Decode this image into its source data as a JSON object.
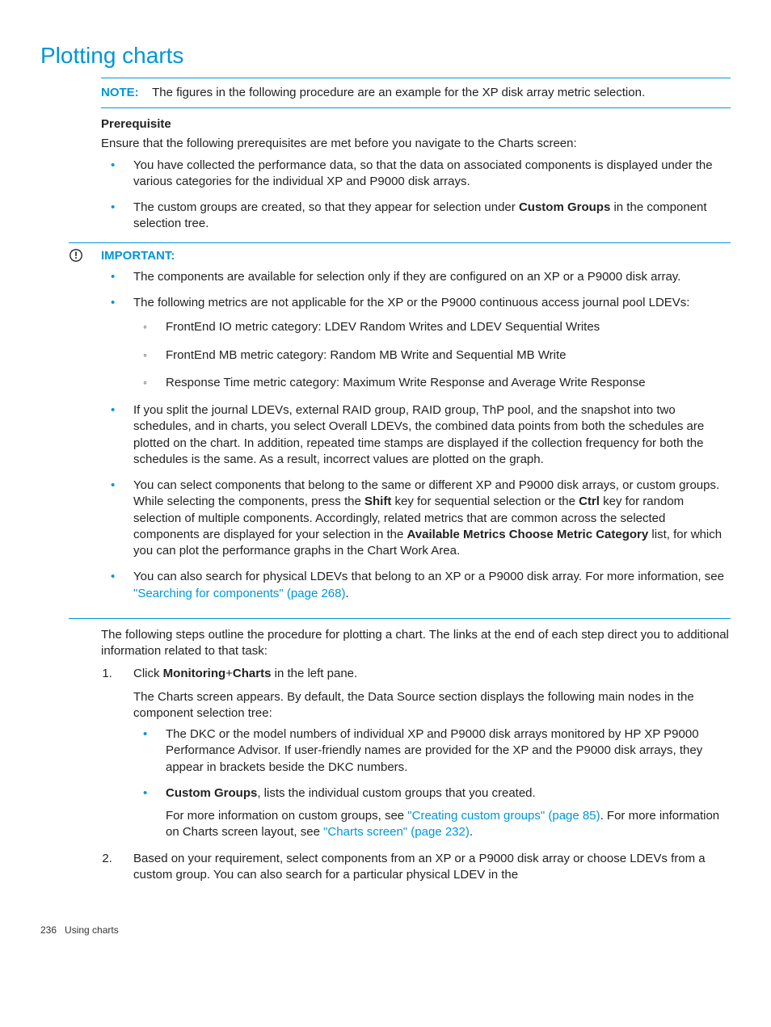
{
  "title": "Plotting charts",
  "note": {
    "label": "NOTE:",
    "text": "The figures in the following procedure are an example for the XP disk array metric selection."
  },
  "prereq": {
    "heading": "Prerequisite",
    "lead": "Ensure that the following prerequisites are met before you navigate to the Charts screen:",
    "item1": "You have collected the performance data, so that the data on associated components is displayed under the various categories for the individual XP and P9000 disk arrays.",
    "item2_a": "The custom groups are created, so that they appear for selection under ",
    "item2_b": "Custom Groups",
    "item2_c": " in the component selection tree."
  },
  "important": {
    "label": "IMPORTANT:",
    "b1": "The components are available for selection only if they are configured on an XP or a P9000 disk array.",
    "b2": "The following metrics are not applicable for the XP or the P9000 continuous access journal pool LDEVs:",
    "b2_s1": "FrontEnd IO metric category: LDEV Random Writes and LDEV Sequential Writes",
    "b2_s2": "FrontEnd MB metric category: Random MB Write and Sequential MB Write",
    "b2_s3": "Response Time metric category: Maximum Write Response and Average Write Response",
    "b3": "If you split the journal LDEVs, external RAID group, RAID group, ThP pool, and the snapshot into two schedules, and in charts, you select Overall LDEVs, the combined data points from both the schedules are plotted on the chart. In addition, repeated time stamps are displayed if the collection frequency for both the schedules is the same. As a result, incorrect values are plotted on the graph.",
    "b4_a": "You can select components that belong to the same or different XP and P9000 disk arrays, or custom groups. While selecting the components, press the ",
    "b4_shift": "Shift",
    "b4_b": " key for sequential selection or the ",
    "b4_ctrl": "Ctrl",
    "b4_c": " key for random selection of multiple components. Accordingly, related metrics that are common across the selected components are displayed for your selection in the ",
    "b4_avail": "Available Metrics Choose Metric Category",
    "b4_d": " list, for which you can plot the performance graphs in the Chart Work Area.",
    "b5_a": "You can also search for physical LDEVs that belong to an XP or a P9000 disk array. For more information, see ",
    "b5_link": "\"Searching for components\" (page 268)",
    "b5_b": "."
  },
  "procedure": {
    "lead": "The following steps outline the procedure for plotting a chart. The links at the end of each step direct you to additional information related to that task:",
    "s1_a": "Click ",
    "s1_monitoring": "Monitoring",
    "s1_plus": "+",
    "s1_charts": "Charts",
    "s1_b": " in the left pane.",
    "s1_p2": "The Charts screen appears. By default, the Data Source section displays the following main nodes in the component selection tree:",
    "s1_l1": "The DKC or the model numbers of individual XP and P9000 disk arrays monitored by HP XP P9000 Performance Advisor. If user-friendly names are provided for the XP and the P9000 disk arrays, they appear in brackets beside the DKC numbers.",
    "s1_l2_cg": "Custom Groups",
    "s1_l2_a": ", lists the individual custom groups that you created.",
    "s1_l2_b": "For more information on custom groups, see ",
    "s1_l2_link1": "\"Creating custom groups\" (page 85)",
    "s1_l2_c": ". For more information on Charts screen layout, see ",
    "s1_l2_link2": "\"Charts screen\" (page 232)",
    "s1_l2_d": ".",
    "s2": "Based on your requirement, select components from an XP or a P9000 disk array or choose LDEVs from a custom group. You can also search for a particular physical LDEV in the"
  },
  "footer": {
    "page": "236",
    "section": "Using charts"
  }
}
